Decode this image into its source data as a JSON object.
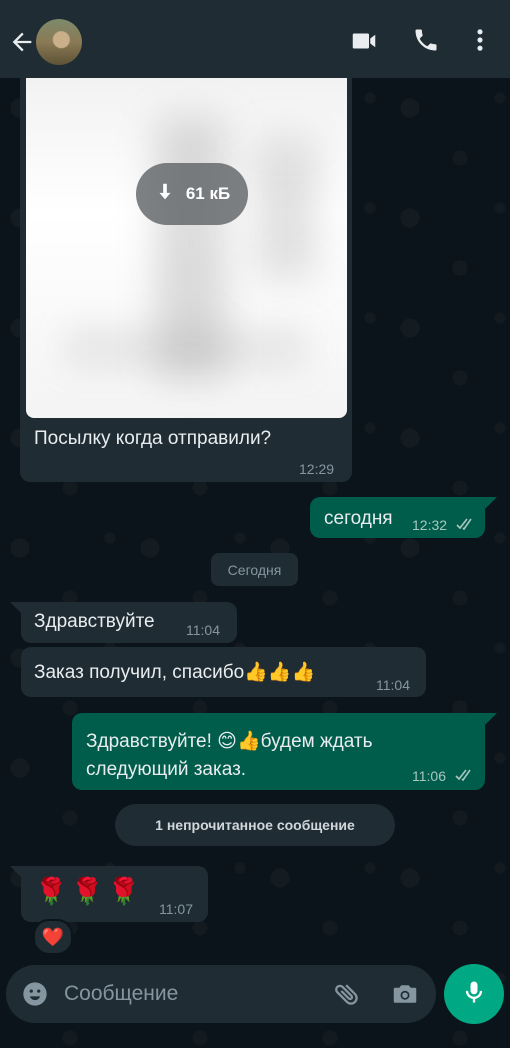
{
  "header": {
    "back_icon": "arrow-left-icon",
    "avatar": "contact-avatar",
    "video_icon": "video-camera-icon",
    "call_icon": "phone-icon",
    "menu_icon": "more-vertical-icon"
  },
  "messages": {
    "image_message": {
      "download_size": "61 кБ",
      "text": "Посылку когда отправили?",
      "time": "12:29"
    },
    "out1": {
      "text": "сегодня",
      "time": "12:32"
    },
    "date_divider": "Сегодня",
    "in1": {
      "text": "Здравствуйте",
      "time": "11:04"
    },
    "in2": {
      "text": "Заказ получил, спасибо👍👍👍",
      "time": "11:04"
    },
    "out2": {
      "line1": "Здравствуйте! 😊👍будем ждать",
      "line2": "следующий заказ.",
      "time": "11:06"
    },
    "unread_divider": "1 непрочитанное сообщение",
    "in3": {
      "text": "🌹🌹🌹",
      "time": "11:07",
      "reaction": "❤️"
    }
  },
  "composer": {
    "placeholder": "Сообщение",
    "emoji_icon": "emoji-icon",
    "attach_icon": "paperclip-icon",
    "camera_icon": "camera-icon",
    "mic_icon": "microphone-icon"
  },
  "colors": {
    "background": "#0b141a",
    "incoming_bubble": "#1f2c34",
    "outgoing_bubble": "#005c4b",
    "accent": "#00a884",
    "timestamp": "#8696a0"
  }
}
